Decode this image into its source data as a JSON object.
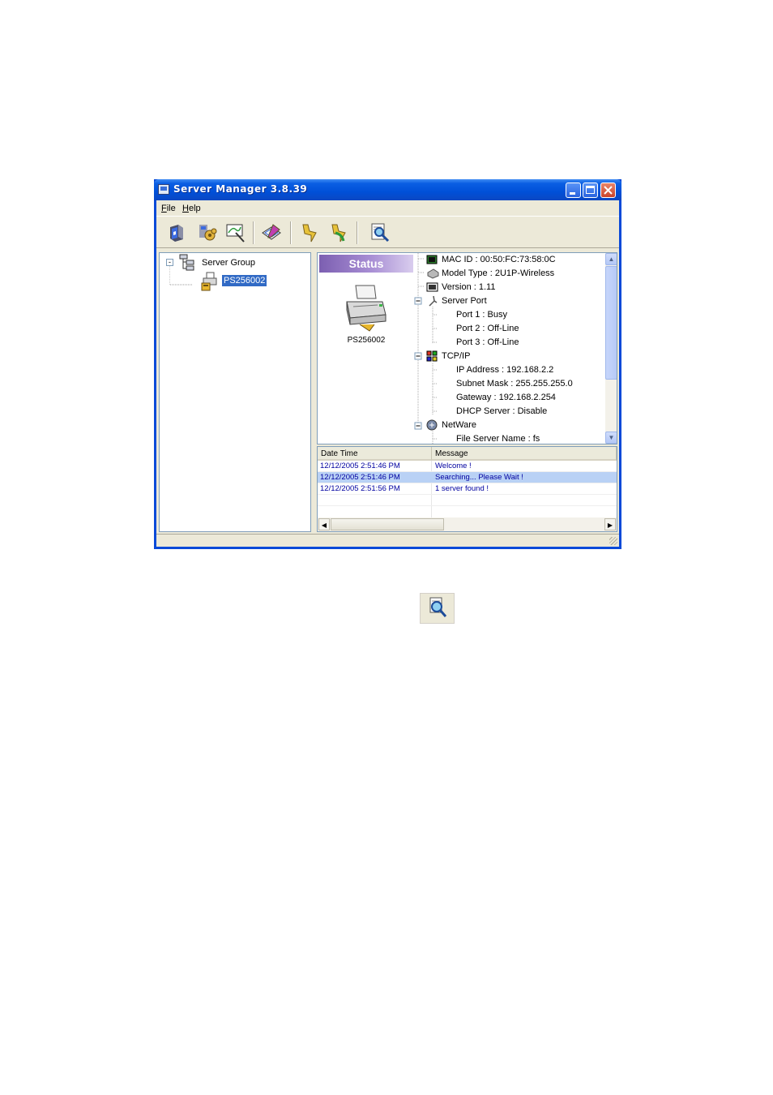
{
  "window": {
    "title": "Server Manager 3.8.39"
  },
  "menu": {
    "items": [
      "File",
      "Help"
    ]
  },
  "toolbar": {
    "buttons": [
      "server-icon",
      "settings-gear-icon",
      "monitor-icon",
      "edit-icon",
      "connect-icon",
      "disconnect-icon",
      "search-icon"
    ]
  },
  "tree": {
    "root_label": "Server Group",
    "child_label": "PS256002"
  },
  "status": {
    "banner": "Status",
    "printer_name": "PS256002",
    "items": {
      "mac": "MAC ID : 00:50:FC:73:58:0C",
      "model": "Model Type : 2U1P-Wireless",
      "version": "Version : 1.11",
      "server_port": "Server Port",
      "port1": "Port 1 : Busy",
      "port2": "Port 2 : Off-Line",
      "port3": "Port 3 : Off-Line",
      "tcpip": "TCP/IP",
      "ip": "IP Address : 192.168.2.2",
      "subnet": "Subnet Mask : 255.255.255.0",
      "gateway": "Gateway : 192.168.2.254",
      "dhcp": "DHCP Server : Disable",
      "netware": "NetWare",
      "file_server": "File Server Name : fs"
    }
  },
  "log": {
    "headers": [
      "Date Time",
      "Message"
    ],
    "rows": [
      {
        "time": "12/12/2005 2:51:46 PM",
        "message": "Welcome !"
      },
      {
        "time": "12/12/2005 2:51:46 PM",
        "message": "Searching... Please Wait !"
      },
      {
        "time": "12/12/2005 2:51:56 PM",
        "message": "1 server found !"
      }
    ]
  },
  "colors": {
    "titlebar": "#0050d8",
    "selection": "#316ac5",
    "log_text": "#0000a0",
    "status_banner": "#a88ed4"
  }
}
